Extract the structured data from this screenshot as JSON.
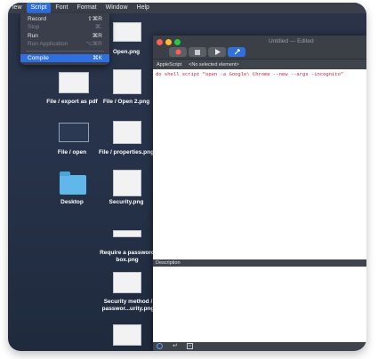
{
  "menubar": {
    "items": [
      "iew",
      "Script",
      "Font",
      "Format",
      "Window",
      "Help"
    ]
  },
  "script_menu": {
    "items": [
      {
        "label": "Record",
        "shortcut": "⇧⌘R"
      },
      {
        "label": "Stop",
        "shortcut": "⌘."
      },
      {
        "label": "Run",
        "shortcut": "⌘R"
      },
      {
        "label": "Run Application",
        "shortcut": "⌥⌘R"
      },
      {
        "label": "Compile",
        "shortcut": "⌘K"
      }
    ]
  },
  "desktop": {
    "icons": [
      {
        "label": "Open.png"
      },
      {
        "label": "File / export as pdf"
      },
      {
        "label": "File / Open 2.png"
      },
      {
        "label": "File / open"
      },
      {
        "label": "File / properties.png"
      },
      {
        "label": "Desktop"
      },
      {
        "label": "Security.png"
      },
      {
        "label": "Require a password box.png"
      },
      {
        "label": "Security method / passwor...urity.png"
      }
    ]
  },
  "editor": {
    "title": "Untitled",
    "title_suffix": "— Edited",
    "language": "AppleScript",
    "element_selector": "<No selected element>",
    "code": "do shell script \"open -a Google\\ Chrome --new --args -incognito\"",
    "description_label": "Description"
  },
  "colors": {
    "accent": "#2f6fe0",
    "code_text": "#c1254a",
    "close": "#fe5f57",
    "minimize": "#febc2e",
    "zoom": "#28c840"
  }
}
